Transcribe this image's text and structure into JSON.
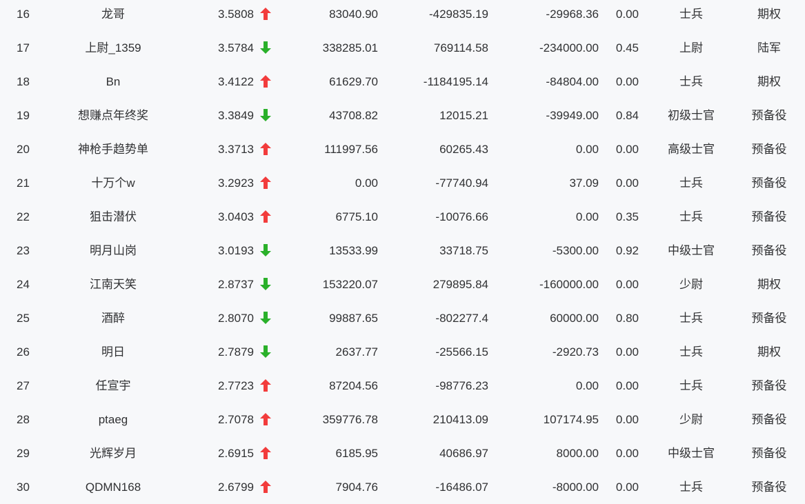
{
  "colors": {
    "up": "#f23c3c",
    "down": "#2ab02a",
    "background": "#f7f8fa",
    "text": "#303133"
  },
  "rows": [
    {
      "rank": "16",
      "name": "龙哥",
      "score": "3.5808",
      "trend": "up",
      "v1": "83040.90",
      "v2": "-429835.19",
      "v3": "-29968.36",
      "v4": "0.00",
      "level": "士兵",
      "type": "期权"
    },
    {
      "rank": "17",
      "name": "上尉_1359",
      "score": "3.5784",
      "trend": "down",
      "v1": "338285.01",
      "v2": "769114.58",
      "v3": "-234000.00",
      "v4": "0.45",
      "level": "上尉",
      "type": "陆军"
    },
    {
      "rank": "18",
      "name": "Bn",
      "score": "3.4122",
      "trend": "up",
      "v1": "61629.70",
      "v2": "-1184195.14",
      "v3": "-84804.00",
      "v4": "0.00",
      "level": "士兵",
      "type": "期权"
    },
    {
      "rank": "19",
      "name": "想赚点年终奖",
      "score": "3.3849",
      "trend": "down",
      "v1": "43708.82",
      "v2": "12015.21",
      "v3": "-39949.00",
      "v4": "0.84",
      "level": "初级士官",
      "type": "预备役"
    },
    {
      "rank": "20",
      "name": "神枪手趋势单",
      "score": "3.3713",
      "trend": "up",
      "v1": "111997.56",
      "v2": "60265.43",
      "v3": "0.00",
      "v4": "0.00",
      "level": "高级士官",
      "type": "预备役"
    },
    {
      "rank": "21",
      "name": "十万个w",
      "score": "3.2923",
      "trend": "up",
      "v1": "0.00",
      "v2": "-77740.94",
      "v3": "37.09",
      "v4": "0.00",
      "level": "士兵",
      "type": "预备役"
    },
    {
      "rank": "22",
      "name": "狙击潜伏",
      "score": "3.0403",
      "trend": "up",
      "v1": "6775.10",
      "v2": "-10076.66",
      "v3": "0.00",
      "v4": "0.35",
      "level": "士兵",
      "type": "预备役"
    },
    {
      "rank": "23",
      "name": "明月山岗",
      "score": "3.0193",
      "trend": "down",
      "v1": "13533.99",
      "v2": "33718.75",
      "v3": "-5300.00",
      "v4": "0.92",
      "level": "中级士官",
      "type": "预备役"
    },
    {
      "rank": "24",
      "name": "江南天笑",
      "score": "2.8737",
      "trend": "down",
      "v1": "153220.07",
      "v2": "279895.84",
      "v3": "-160000.00",
      "v4": "0.00",
      "level": "少尉",
      "type": "期权"
    },
    {
      "rank": "25",
      "name": "酒醉",
      "score": "2.8070",
      "trend": "down",
      "v1": "99887.65",
      "v2": "-802277.4",
      "v3": "60000.00",
      "v4": "0.80",
      "level": "士兵",
      "type": "预备役"
    },
    {
      "rank": "26",
      "name": "明日",
      "score": "2.7879",
      "trend": "down",
      "v1": "2637.77",
      "v2": "-25566.15",
      "v3": "-2920.73",
      "v4": "0.00",
      "level": "士兵",
      "type": "期权"
    },
    {
      "rank": "27",
      "name": "任宣宇",
      "score": "2.7723",
      "trend": "up",
      "v1": "87204.56",
      "v2": "-98776.23",
      "v3": "0.00",
      "v4": "0.00",
      "level": "士兵",
      "type": "预备役"
    },
    {
      "rank": "28",
      "name": "ptaeg",
      "score": "2.7078",
      "trend": "up",
      "v1": "359776.78",
      "v2": "210413.09",
      "v3": "107174.95",
      "v4": "0.00",
      "level": "少尉",
      "type": "预备役"
    },
    {
      "rank": "29",
      "name": "光辉岁月",
      "score": "2.6915",
      "trend": "up",
      "v1": "6185.95",
      "v2": "40686.97",
      "v3": "8000.00",
      "v4": "0.00",
      "level": "中级士官",
      "type": "预备役"
    },
    {
      "rank": "30",
      "name": "QDMN168",
      "score": "2.6799",
      "trend": "up",
      "v1": "7904.76",
      "v2": "-16486.07",
      "v3": "-8000.00",
      "v4": "0.00",
      "level": "士兵",
      "type": "预备役"
    }
  ]
}
